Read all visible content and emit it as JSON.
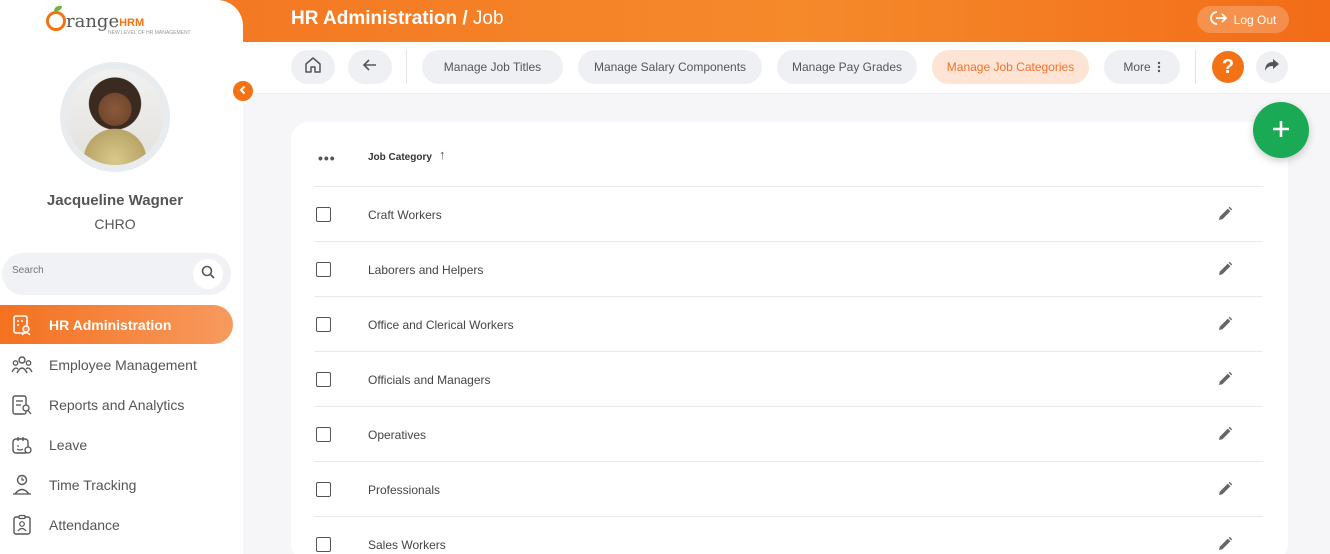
{
  "header": {
    "title_main": "HR Administration /",
    "title_sub": "Job",
    "logout_label": "Log Out"
  },
  "brand": {
    "logo_main": "range",
    "logo_hrm": "HRM",
    "logo_tagline": "NEW LEVEL OF HR MANAGEMENT"
  },
  "user": {
    "name": "Jacqueline Wagner",
    "role": "CHRO"
  },
  "search": {
    "placeholder": "Search"
  },
  "sidebar": {
    "items": [
      {
        "label": "HR Administration",
        "icon": "hr-admin-icon",
        "active": true
      },
      {
        "label": "Employee Management",
        "icon": "people-icon",
        "active": false
      },
      {
        "label": "Reports and Analytics",
        "icon": "report-icon",
        "active": false
      },
      {
        "label": "Leave",
        "icon": "leave-icon",
        "active": false
      },
      {
        "label": "Time Tracking",
        "icon": "clock-icon",
        "active": false
      },
      {
        "label": "Attendance",
        "icon": "attendance-icon",
        "active": false
      }
    ]
  },
  "tabs": [
    {
      "label": "Manage Job Titles",
      "active": false
    },
    {
      "label": "Manage Salary Components",
      "active": false
    },
    {
      "label": "Manage Pay Grades",
      "active": false
    },
    {
      "label": "Manage Job Categories",
      "active": true
    },
    {
      "label": "More",
      "active": false
    }
  ],
  "table": {
    "column_header": "Job Category",
    "sort_indicator": "↑",
    "rows": [
      "Craft Workers",
      "Laborers and Helpers",
      "Office and Clerical Workers",
      "Officials and Managers",
      "Operatives",
      "Professionals",
      "Sales Workers"
    ]
  },
  "colors": {
    "accent": "#f47216",
    "fab": "#1aaa55",
    "active_tab_bg": "#fde4d4"
  }
}
